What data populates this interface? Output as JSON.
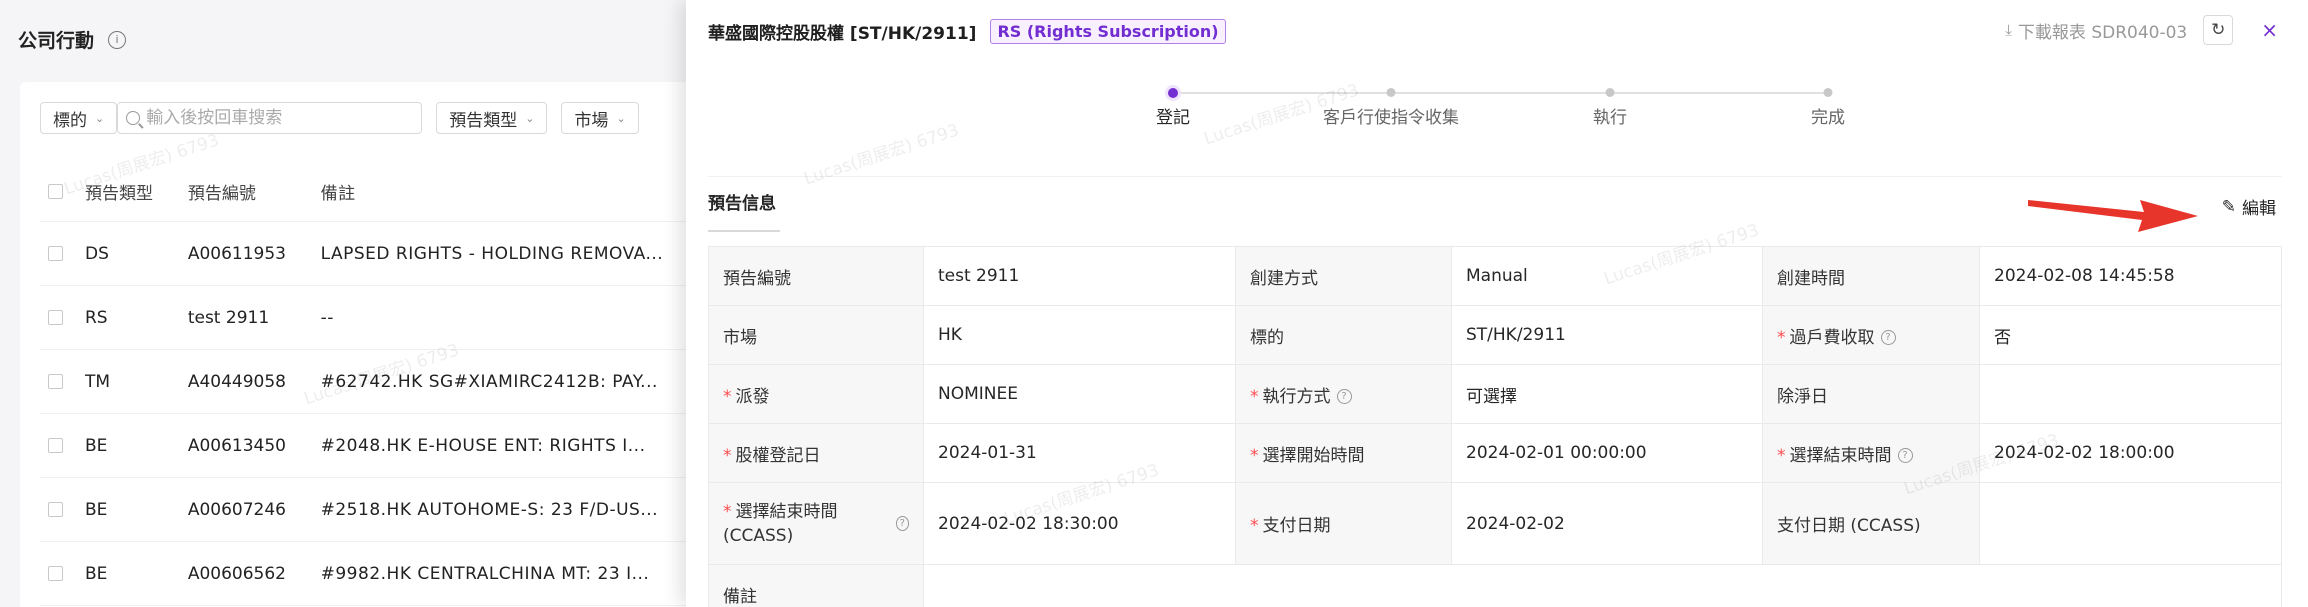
{
  "background_page": {
    "title": "公司行動",
    "filters": {
      "underlying_select": "標的",
      "search_placeholder": "輸入後按回車搜索",
      "announcement_type_select": "預告類型",
      "market_select": "市場"
    },
    "table": {
      "headers": [
        "預告類型",
        "預告編號",
        "備註"
      ],
      "rows": [
        {
          "type": "DS",
          "code": "A00611953",
          "note": "LAPSED RIGHTS - HOLDING REMOVA..."
        },
        {
          "type": "RS",
          "code": "test 2911",
          "note": "--"
        },
        {
          "type": "TM",
          "code": "A40449058",
          "note": "#62742.HK SG#XIAMIRC2412B: PAY..."
        },
        {
          "type": "BE",
          "code": "A00613450",
          "note": "#2048.HK E-HOUSE ENT: RIGHTS I..."
        },
        {
          "type": "BE",
          "code": "A00607246",
          "note": "#2518.HK AUTOHOME-S: 23 F/D-US..."
        },
        {
          "type": "BE",
          "code": "A00606562",
          "note": "#9982.HK CENTRALCHINA MT: 23 I..."
        }
      ]
    }
  },
  "drawer": {
    "title": "華盛國際控股股權 [ST/HK/2911]",
    "tag": "RS (Rights Subscription)",
    "download_label": "下載報表 SDR040-03",
    "close_icon": "×",
    "steps": [
      {
        "label": "登記",
        "active": true
      },
      {
        "label": "客戶行使指令收集",
        "active": false
      },
      {
        "label": "執行",
        "active": false
      },
      {
        "label": "完成",
        "active": false
      }
    ],
    "section_title": "預告信息",
    "edit_label": "編輯",
    "details": {
      "r1": {
        "l1": "預告編號",
        "v1": "test 2911",
        "l2": "創建方式",
        "v2": "Manual",
        "l3": "創建時間",
        "v3": "2024-02-08 14:45:58"
      },
      "r2": {
        "l1": "市場",
        "v1": "HK",
        "l2": "標的",
        "v2": "ST/HK/2911",
        "l3": "過戶費收取",
        "v3": "否"
      },
      "r3": {
        "l1": "派發",
        "v1": "NOMINEE",
        "l2": "執行方式",
        "v2": "可選擇",
        "l3": "除淨日",
        "v3": ""
      },
      "r4": {
        "l1": "股權登記日",
        "v1": "2024-01-31",
        "l2": "選擇開始時間",
        "v2": "2024-02-01 00:00:00",
        "l3": "選擇結束時間",
        "v3": "2024-02-02 18:00:00"
      },
      "r5": {
        "l1": "選擇結束時間 (CCASS)",
        "v1": "2024-02-02 18:30:00",
        "l2": "支付日期",
        "v2": "2024-02-02",
        "l3": "支付日期 (CCASS)",
        "v3": ""
      },
      "r6": {
        "l1": "備註"
      }
    }
  },
  "watermark_text": "Lucas(周展宏) 6793",
  "colors": {
    "accent": "#722ed1",
    "required": "#ff4d4f",
    "arrow": "#e8352c"
  }
}
